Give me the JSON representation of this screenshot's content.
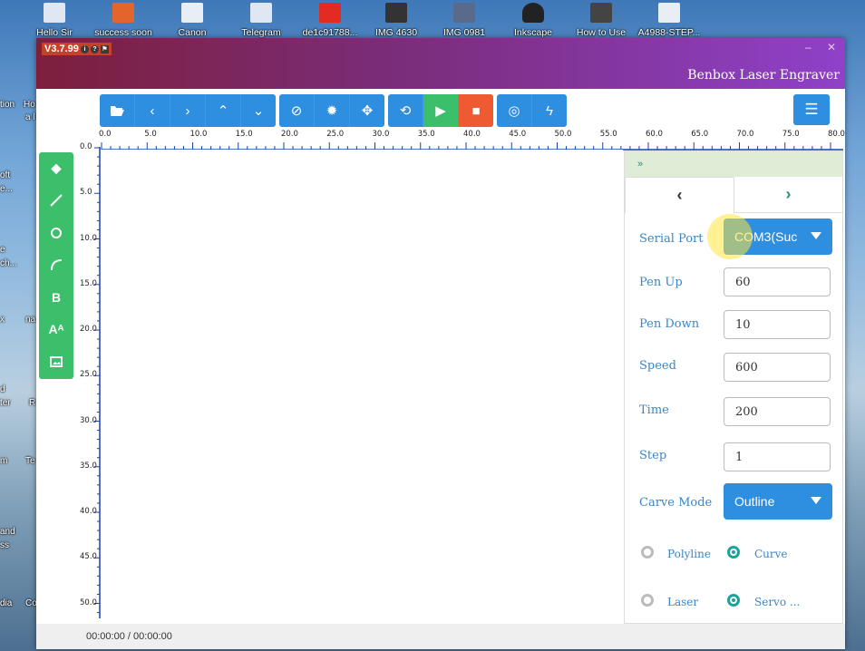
{
  "desktop": {
    "icons": [
      "Hello Sir",
      "success soon",
      "Canon",
      "Telegram",
      "de1c91788...",
      "IMG 4630",
      "IMG 0981",
      "Inkscape",
      "How to Use",
      "A4988-STEP..."
    ],
    "side_labels": [
      "tion",
      "Ho",
      "a l",
      "oft",
      "e...",
      "e",
      "ch...",
      "x",
      "na",
      "d",
      "ter",
      "R",
      "m",
      "Te",
      "and",
      "ss",
      "dia",
      "Co"
    ]
  },
  "window": {
    "version": "V3.7.99",
    "app_title": "Benbox Laser Engraver",
    "minimize": "–",
    "close": "✕"
  },
  "toolbar": {
    "groups": [
      [
        "open-icon",
        "chevron-left-icon",
        "chevron-right-icon",
        "chevron-up-icon",
        "chevron-down-icon"
      ],
      [
        "ban-icon",
        "sun-icon",
        "crosshair-icon"
      ],
      [
        "loop-icon",
        "play-icon",
        "stop-icon"
      ],
      [
        "target-icon",
        "bolt-icon"
      ]
    ],
    "menu_icon": "hamburger-icon"
  },
  "left_tools": [
    "tag-icon",
    "line-icon",
    "circle-icon",
    "arc-icon",
    "bold-text-icon",
    "font-icon",
    "image-icon"
  ],
  "left_tool_glyphs": {
    "bold": "B",
    "font": "Aᴬ"
  },
  "ruler": {
    "x_labels": [
      "0.0",
      "5.0",
      "10.0",
      "15.0",
      "20.0",
      "25.0",
      "30.0",
      "35.0",
      "40.0",
      "45.0",
      "50.0",
      "55.0",
      "60.0",
      "65.0",
      "70.0",
      "75.0",
      "80.0"
    ],
    "y_labels": [
      "0.0",
      "5.0",
      "10.0",
      "15.0",
      "20.0",
      "25.0",
      "30.0",
      "35.0",
      "40.0",
      "45.0",
      "50.0"
    ]
  },
  "panel": {
    "collapse": "»",
    "tab_left": "‹",
    "tab_right": "›",
    "serial_port_label": "Serial Port",
    "serial_port_value": "COM3(Suc",
    "pen_up_label": "Pen Up",
    "pen_up_value": "60",
    "pen_down_label": "Pen Down",
    "pen_down_value": "10",
    "speed_label": "Speed",
    "speed_value": "600",
    "time_label": "Time",
    "time_value": "200",
    "step_label": "Step",
    "step_value": "1",
    "carve_mode_label": "Carve Mode",
    "carve_mode_value": "Outline",
    "radio_polyline": "Polyline",
    "radio_curve": "Curve",
    "radio_laser": "Laser",
    "radio_servo": "Servo ..."
  },
  "status": {
    "time": "00:00:00 / 00:00:00"
  },
  "colors": {
    "primary": "#2e8ee0",
    "green": "#3cbf6a",
    "red": "#ef5a33",
    "teal": "#1aa39a"
  }
}
